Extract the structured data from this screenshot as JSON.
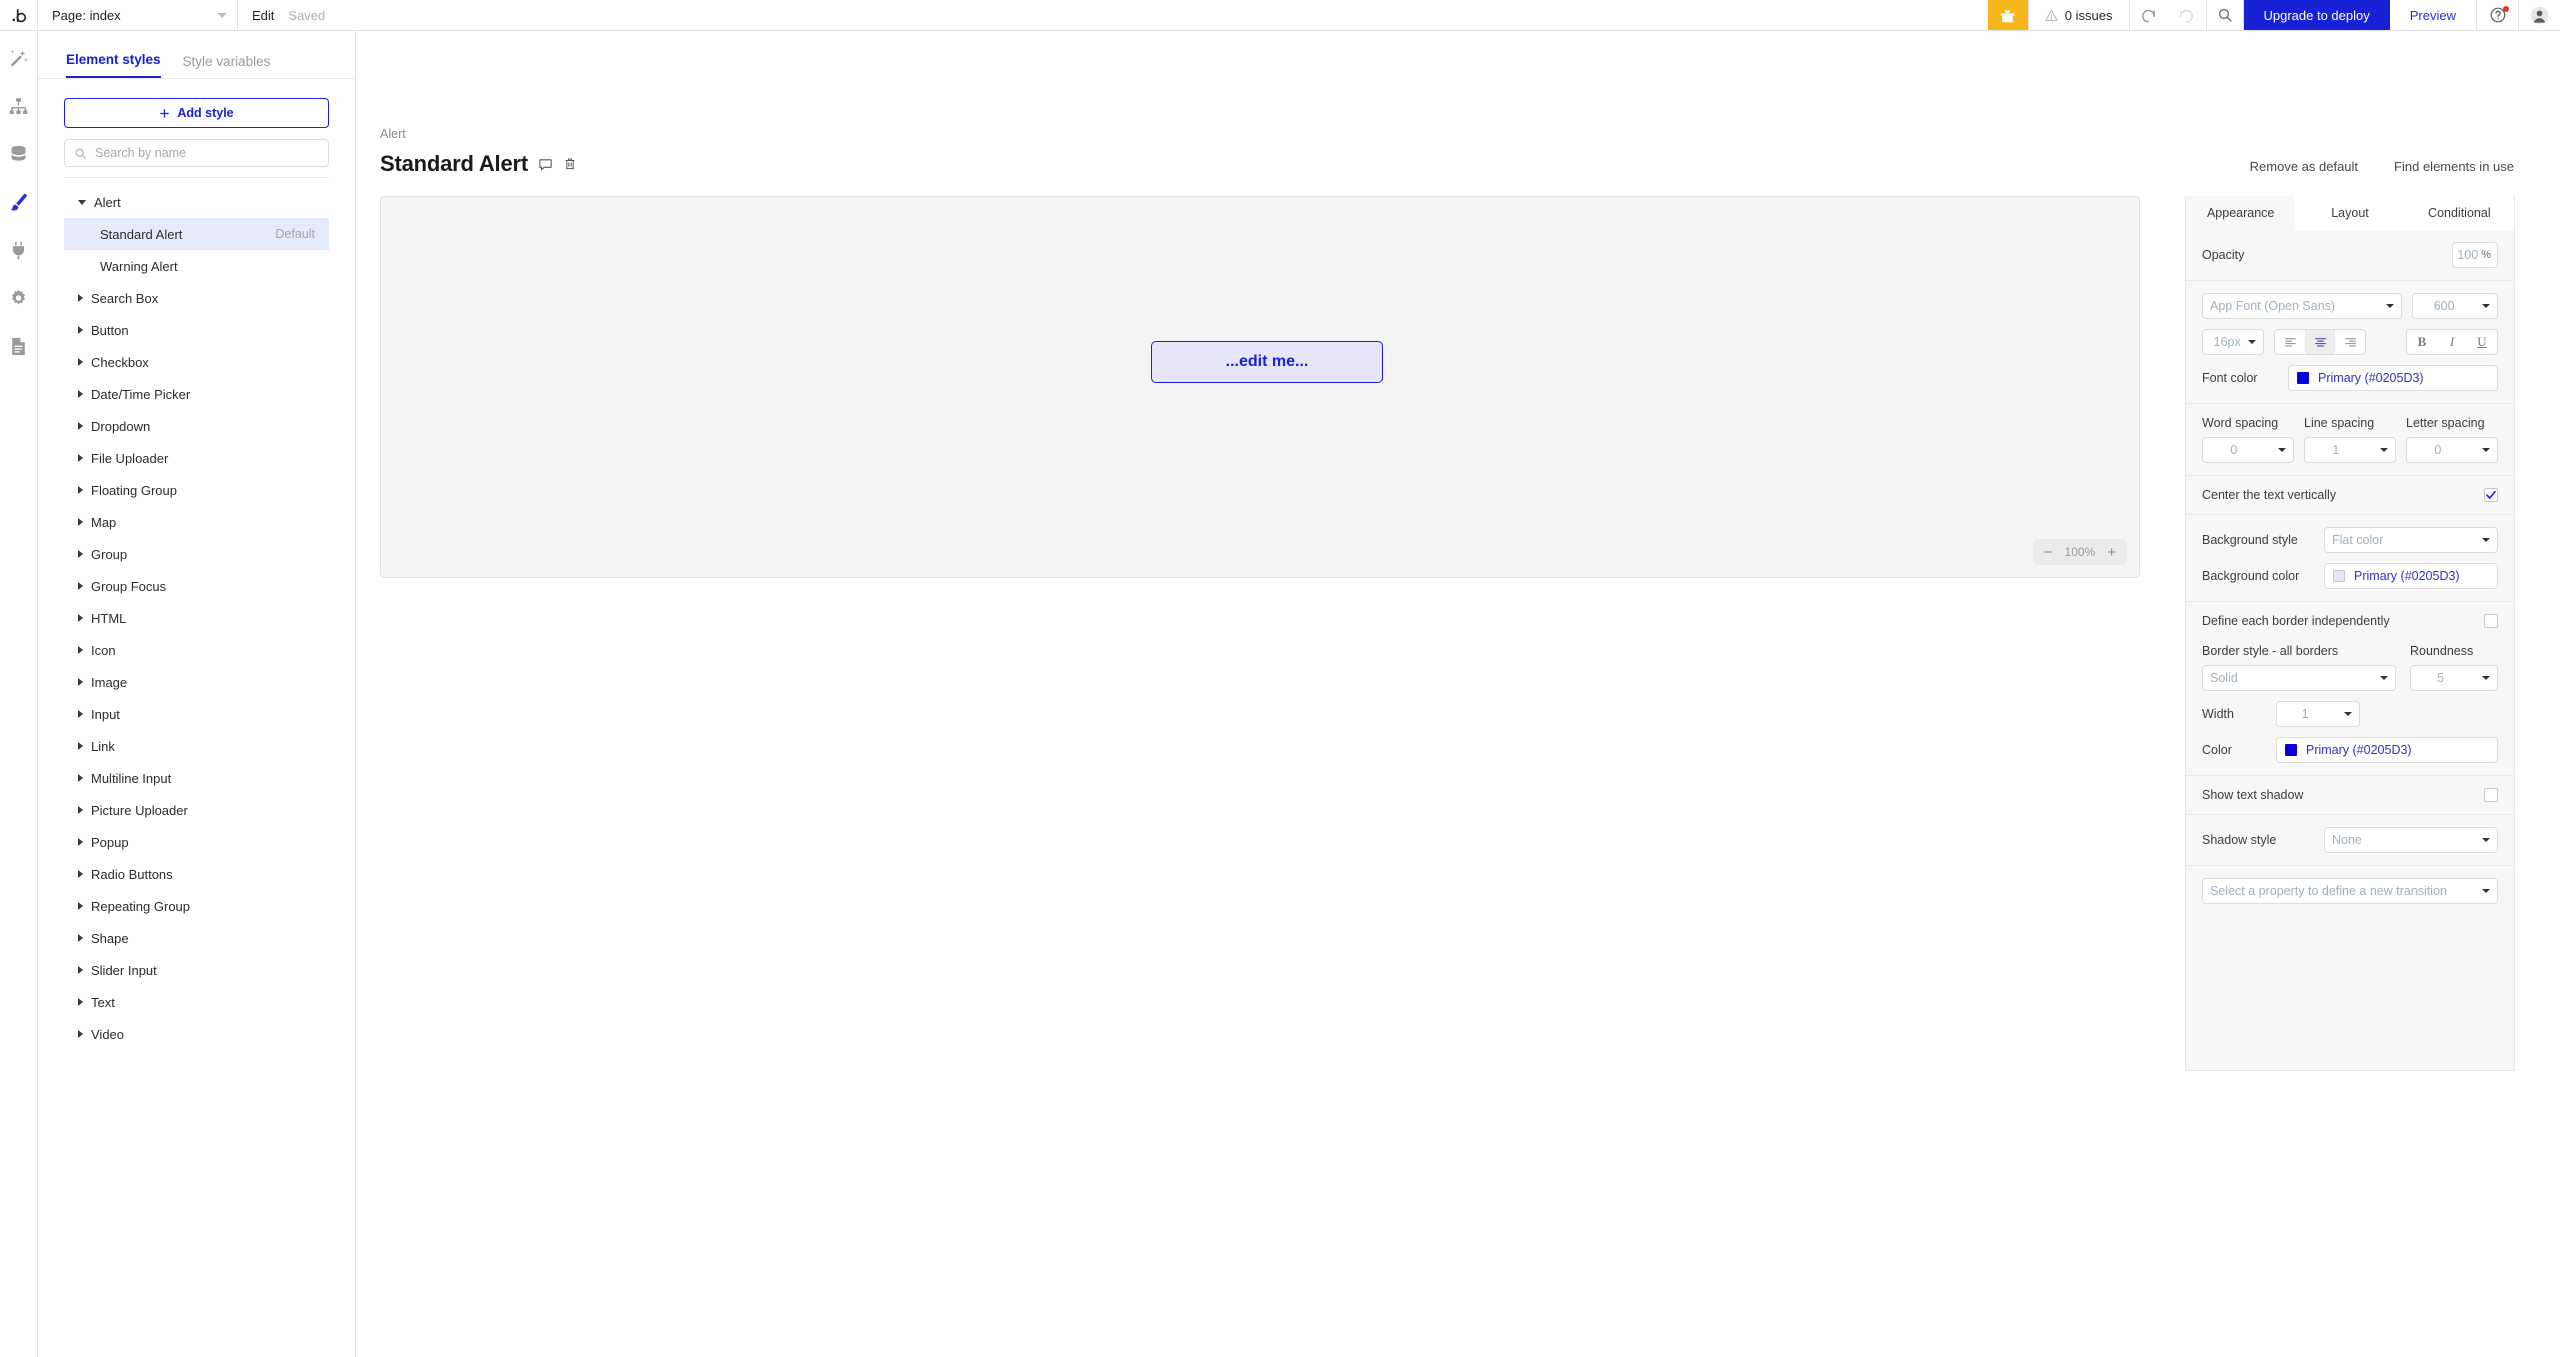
{
  "topbar": {
    "logo": "bubble-logo",
    "page_label": "Page: index",
    "edit_label": "Edit",
    "saved_label": "Saved",
    "gift_icon": "gift-icon",
    "issues_label": "0 issues",
    "warning_icon": "warning-icon",
    "undo_icon": "undo-icon",
    "redo_icon": "redo-icon",
    "search_icon": "search-icon",
    "deploy_label": "Upgrade to deploy",
    "preview_label": "Preview",
    "help_icon": "help-circle-icon",
    "avatar_icon": "user-avatar-icon",
    "accent": "#1721d6",
    "gift_bg": "#f5b719"
  },
  "rail": {
    "items": [
      {
        "icon": "design-wand-icon",
        "active": false
      },
      {
        "icon": "workflow-tree-icon",
        "active": false
      },
      {
        "icon": "database-icon",
        "active": false
      },
      {
        "icon": "styles-paintbrush-icon",
        "active": true
      },
      {
        "icon": "plugins-plug-icon",
        "active": false
      },
      {
        "icon": "settings-gear-icon",
        "active": false
      },
      {
        "icon": "logs-document-icon",
        "active": false
      }
    ]
  },
  "left_panel": {
    "tabs": [
      {
        "label": "Element styles",
        "active": true
      },
      {
        "label": "Style variables",
        "active": false
      }
    ],
    "add_style_label": "Add style",
    "add_style_icon": "plus-icon",
    "search_placeholder": "Search by name",
    "search_icon": "search-icon",
    "groups": [
      {
        "label": "Alert",
        "expanded": true,
        "children": [
          {
            "label": "Standard Alert",
            "tag": "Default",
            "selected": true
          },
          {
            "label": "Warning Alert",
            "tag": "",
            "selected": false
          }
        ]
      },
      {
        "label": "Search Box",
        "expanded": false,
        "children": []
      },
      {
        "label": "Button",
        "expanded": false,
        "children": []
      },
      {
        "label": "Checkbox",
        "expanded": false,
        "children": []
      },
      {
        "label": "Date/Time Picker",
        "expanded": false,
        "children": []
      },
      {
        "label": "Dropdown",
        "expanded": false,
        "children": []
      },
      {
        "label": "File Uploader",
        "expanded": false,
        "children": []
      },
      {
        "label": "Floating Group",
        "expanded": false,
        "children": []
      },
      {
        "label": "Map",
        "expanded": false,
        "children": []
      },
      {
        "label": "Group",
        "expanded": false,
        "children": []
      },
      {
        "label": "Group Focus",
        "expanded": false,
        "children": []
      },
      {
        "label": "HTML",
        "expanded": false,
        "children": []
      },
      {
        "label": "Icon",
        "expanded": false,
        "children": []
      },
      {
        "label": "Image",
        "expanded": false,
        "children": []
      },
      {
        "label": "Input",
        "expanded": false,
        "children": []
      },
      {
        "label": "Link",
        "expanded": false,
        "children": []
      },
      {
        "label": "Multiline Input",
        "expanded": false,
        "children": []
      },
      {
        "label": "Picture Uploader",
        "expanded": false,
        "children": []
      },
      {
        "label": "Popup",
        "expanded": false,
        "children": []
      },
      {
        "label": "Radio Buttons",
        "expanded": false,
        "children": []
      },
      {
        "label": "Repeating Group",
        "expanded": false,
        "children": []
      },
      {
        "label": "Shape",
        "expanded": false,
        "children": []
      },
      {
        "label": "Slider Input",
        "expanded": false,
        "children": []
      },
      {
        "label": "Text",
        "expanded": false,
        "children": []
      },
      {
        "label": "Video",
        "expanded": false,
        "children": []
      }
    ]
  },
  "main": {
    "breadcrumb": "Alert",
    "title": "Standard Alert",
    "comment_icon": "comment-icon",
    "delete_icon": "trash-icon",
    "remove_default_label": "Remove as default",
    "find_elements_label": "Find elements in use",
    "preview_text": "...edit me...",
    "zoom": {
      "minus": "−",
      "value": "100%",
      "plus": "+"
    }
  },
  "properties": {
    "tabs": [
      {
        "label": "Appearance",
        "active": true
      },
      {
        "label": "Layout",
        "active": false
      },
      {
        "label": "Conditional",
        "active": false
      }
    ],
    "opacity": {
      "label": "Opacity",
      "value": "100",
      "unit": "%"
    },
    "font": {
      "family": "App Font (Open Sans)",
      "weight": "600",
      "size": "16px"
    },
    "align": {
      "left": "align-left-icon",
      "center": "align-center-icon",
      "right": "align-right-icon",
      "selected": "center"
    },
    "text_style": {
      "bold": "B",
      "italic": "I",
      "underline": "U"
    },
    "font_color": {
      "label": "Font color",
      "value": "Primary (#0205D3)",
      "swatch": "#0a00d8"
    },
    "spacing": {
      "word": {
        "label": "Word spacing",
        "value": "0"
      },
      "line": {
        "label": "Line spacing",
        "value": "1"
      },
      "letter": {
        "label": "Letter spacing",
        "value": "0"
      }
    },
    "center_vertically": {
      "label": "Center the text vertically",
      "checked": true
    },
    "background_style": {
      "label": "Background style",
      "value": "Flat color"
    },
    "background_color": {
      "label": "Background color",
      "value": "Primary (#0205D3)",
      "swatch": "#e6e6f8"
    },
    "define_borders": {
      "label": "Define each border independently",
      "checked": false
    },
    "border_style": {
      "label": "Border style - all borders",
      "value": "Solid"
    },
    "roundness": {
      "label": "Roundness",
      "value": "5"
    },
    "border_width": {
      "label": "Width",
      "value": "1"
    },
    "border_color": {
      "label": "Color",
      "value": "Primary (#0205D3)",
      "swatch": "#0a00d8"
    },
    "text_shadow": {
      "label": "Show text shadow",
      "checked": false
    },
    "shadow_style": {
      "label": "Shadow style",
      "value": "None"
    },
    "transition": {
      "placeholder": "Select a property to define a new transition"
    }
  }
}
